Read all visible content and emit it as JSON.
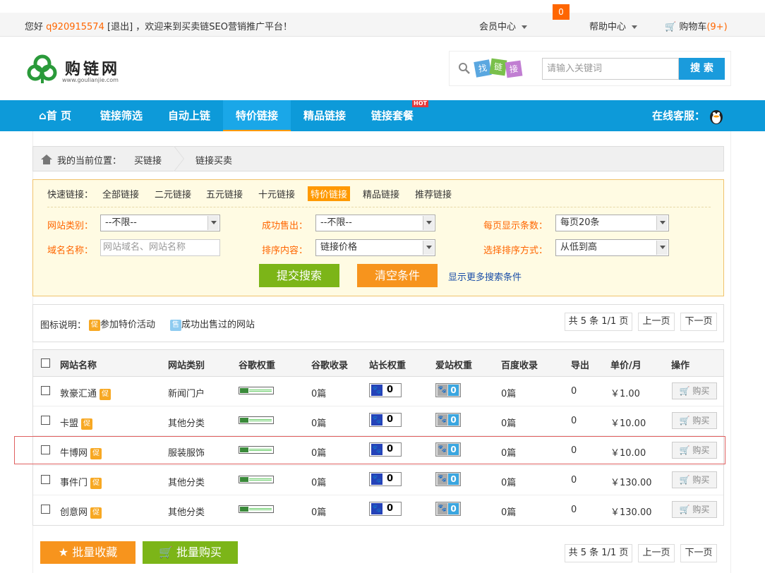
{
  "topbar": {
    "greeting": "您好",
    "username": "q920915574",
    "logout": "[退出]",
    "welcome": "，欢迎来到买卖链SEO营销推广平台！",
    "member_center": "会员中心",
    "msg_count": "0",
    "help_center": "帮助中心",
    "cart_label": "购物车",
    "cart_count": "(9+)"
  },
  "logo": {
    "title": "购链网",
    "subtitle": "www.goulianjie.com"
  },
  "search": {
    "badge": "找链接",
    "placeholder": "请输入关键词",
    "button": "搜 索"
  },
  "nav": {
    "items": [
      "首 页",
      "链接筛选",
      "自动上链",
      "特价链接",
      "精品链接",
      "链接套餐"
    ],
    "hot": "HOT",
    "service": "在线客服："
  },
  "breadcrumb": {
    "prefix": "我的当前位置：",
    "level1": "买链接",
    "level2": "链接买卖"
  },
  "filter": {
    "quick_label": "快速链接：",
    "quick_items": [
      "全部链接",
      "二元链接",
      "五元链接",
      "十元链接",
      "特价链接",
      "精品链接",
      "推荐链接"
    ],
    "site_type_label": "网站类别：",
    "site_type_value": "--不限--",
    "sold_label": "成功售出：",
    "sold_value": "--不限--",
    "perpage_label": "每页显示条数：",
    "perpage_value": "每页20条",
    "domain_label": "域名名称：",
    "domain_placeholder": "网站域名、网站名称",
    "sort_label": "排序内容：",
    "sort_value": "链接价格",
    "order_label": "选择排序方式：",
    "order_value": "从低到高",
    "submit": "提交搜索",
    "clear": "清空条件",
    "more": "显示更多搜索条件"
  },
  "legend": {
    "label": "图标说明：",
    "cu_tag": "促",
    "cu_text": "参加特价活动",
    "shou_tag": "售",
    "shou_text": "成功出售过的网站"
  },
  "pagination": {
    "total": "共 5 条 1/1 页",
    "prev": "上一页",
    "next": "下一页"
  },
  "table": {
    "headers": [
      "网站名称",
      "网站类别",
      "谷歌权重",
      "谷歌收录",
      "站长权重",
      "爱站权重",
      "百度收录",
      "导出",
      "单价/月",
      "操作"
    ],
    "rows": [
      {
        "name": "敦豪汇通",
        "category": "新闻门户",
        "google_pr": "0",
        "google_index": "0篇",
        "zz_weight": "0",
        "az_weight": "0",
        "baidu_index": "0篇",
        "export": "0",
        "price": "￥1.00",
        "action": "购买"
      },
      {
        "name": "卡盟",
        "category": "其他分类",
        "google_pr": "0",
        "google_index": "0篇",
        "zz_weight": "0",
        "az_weight": "0",
        "baidu_index": "0篇",
        "export": "0",
        "price": "￥10.00",
        "action": "购买"
      },
      {
        "name": "牛博网",
        "category": "服装服饰",
        "google_pr": "0",
        "google_index": "0篇",
        "zz_weight": "0",
        "az_weight": "0",
        "baidu_index": "0篇",
        "export": "0",
        "price": "￥10.00",
        "action": "购买"
      },
      {
        "name": "事件门",
        "category": "其他分类",
        "google_pr": "0",
        "google_index": "0篇",
        "zz_weight": "0",
        "az_weight": "0",
        "baidu_index": "0篇",
        "export": "0",
        "price": "￥130.00",
        "action": "购买"
      },
      {
        "name": "创意网",
        "category": "其他分类",
        "google_pr": "0",
        "google_index": "0篇",
        "zz_weight": "0",
        "az_weight": "0",
        "baidu_index": "0篇",
        "export": "0",
        "price": "￥130.00",
        "action": "购买"
      }
    ]
  },
  "bottom": {
    "batch_fav": "批量收藏",
    "batch_buy": "批量购买"
  },
  "colors": {
    "accent": "#0d9ad9",
    "orange": "#f7941d",
    "green": "#7cb518"
  }
}
